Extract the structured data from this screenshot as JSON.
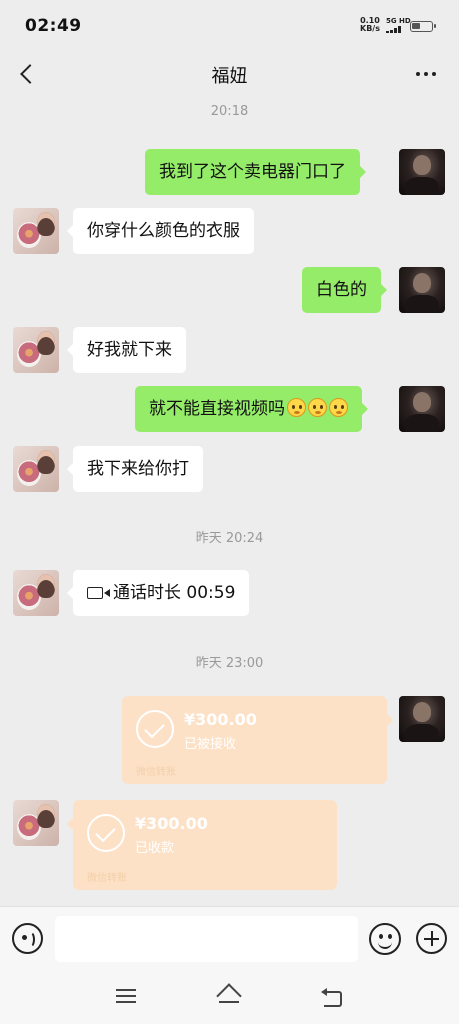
{
  "status_bar": {
    "time": "02:49",
    "net_speed_value": "0.10",
    "net_speed_unit": "KB/s",
    "signal_label": "5G HD"
  },
  "header": {
    "title": "福妞"
  },
  "messages": {
    "ts1": "20:18",
    "m1": "我到了这个卖电器门口了",
    "m2": "你穿什么颜色的衣服",
    "m3": "白色的",
    "m4": "好我就下来",
    "m5": "就不能直接视频吗",
    "m6": "我下来给你打",
    "ts2": "昨天 20:24",
    "m7": "通话时长 00:59",
    "ts3": "昨天 23:00"
  },
  "transfers": {
    "sent": {
      "amount": "¥300.00",
      "status": "已被接收",
      "footer": "微信转账"
    },
    "received": {
      "amount": "¥300.00",
      "status": "已收款",
      "footer": "微信转账"
    }
  },
  "colors": {
    "my_bubble": "#95ec69",
    "their_bubble": "#ffffff",
    "transfer_card": "#fde1c6",
    "background": "#ededed"
  },
  "icons": {
    "back": "back-arrow-icon",
    "more": "more-dots-icon",
    "voice": "voice-icon",
    "emoji": "emoji-icon",
    "plus": "plus-icon",
    "video_call": "video-call-icon"
  }
}
